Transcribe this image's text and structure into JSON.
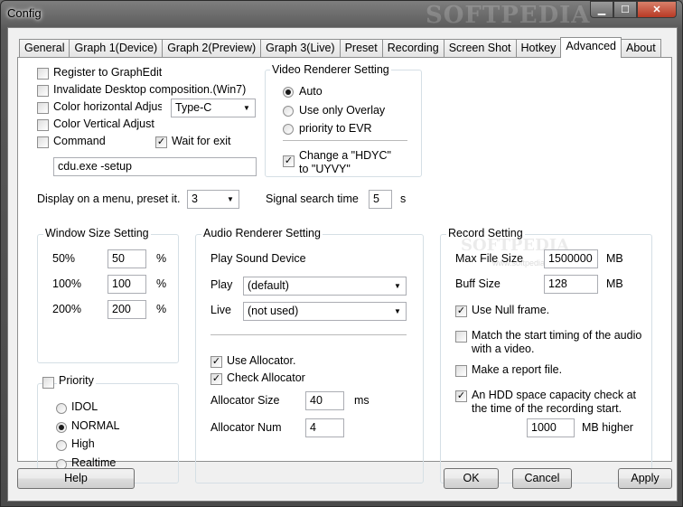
{
  "window": {
    "title": "Config",
    "watermark": "SOFTPEDIA"
  },
  "tabs": [
    "General",
    "Graph 1(Device)",
    "Graph 2(Preview)",
    "Graph 3(Live)",
    "Preset",
    "Recording",
    "Screen Shot",
    "Hotkey",
    "Advanced",
    "About"
  ],
  "left": {
    "register": "Register to GraphEdit",
    "invalidate": "Invalidate Desktop composition.(Win7)",
    "color_h": "Color horizontal Adjust",
    "color_h_value": "Type-C",
    "color_v": "Color Vertical Adjust",
    "command": "Command",
    "wait_exit": "Wait for exit",
    "command_value": "cdu.exe -setup"
  },
  "video": {
    "title": "Video Renderer Setting",
    "auto": "Auto",
    "overlay": "Use only Overlay",
    "evr": "priority to EVR",
    "hdyc1": "Change a \"HDYC\"",
    "hdyc2": "to \"UYVY\""
  },
  "menu": {
    "label": "Display on a menu, preset it.",
    "value": "3"
  },
  "signal": {
    "label": "Signal search time",
    "value": "5",
    "unit": "s"
  },
  "window_size": {
    "title": "Window Size Setting",
    "rows": [
      {
        "label": "50%",
        "value": "50",
        "unit": "%"
      },
      {
        "label": "100%",
        "value": "100",
        "unit": "%"
      },
      {
        "label": "200%",
        "value": "200",
        "unit": "%"
      }
    ]
  },
  "priority": {
    "title": "Priority",
    "options": [
      "IDOL",
      "NORMAL",
      "High",
      "Realtime"
    ]
  },
  "audio": {
    "title": "Audio Renderer Setting",
    "play_sound": "Play Sound Device",
    "play": "Play",
    "play_value": "(default)",
    "live": "Live",
    "live_value": "(not used)",
    "use_alloc": "Use Allocator.",
    "check_alloc": "Check Allocator",
    "alloc_size": "Allocator Size",
    "alloc_size_value": "40",
    "alloc_size_unit": "ms",
    "alloc_num": "Allocator Num",
    "alloc_num_value": "4"
  },
  "record": {
    "title": "Record Setting",
    "watermark": "SOFTPEDIA",
    "watermark_url": "www.softpedia.com",
    "max_file": "Max File Size",
    "max_file_value": "1500000",
    "max_file_unit": "MB",
    "buff": "Buff Size",
    "buff_value": "128",
    "buff_unit": "MB",
    "null_frame": "Use Null frame.",
    "match1": "Match the start timing of the audio",
    "match2": "with a video.",
    "report": "Make a report file.",
    "hdd1": "An HDD space capacity check at",
    "hdd2": "the time of the recording start.",
    "hdd_value": "1000",
    "hdd_unit": "MB higher"
  },
  "buttons": {
    "help": "Help",
    "ok": "OK",
    "cancel": "Cancel",
    "apply": "Apply"
  }
}
